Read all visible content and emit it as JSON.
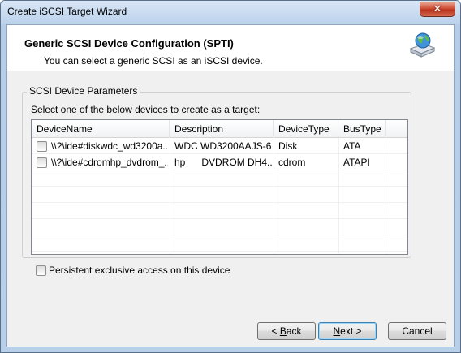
{
  "window": {
    "title": "Create iSCSI Target Wizard",
    "close_glyph": "✕"
  },
  "header": {
    "title": "Generic SCSI Device Configuration (SPTI)",
    "subtitle": "You can select a generic SCSI as an iSCSI device.",
    "icon": "globe-drive-icon"
  },
  "group": {
    "legend": "SCSI Device Parameters",
    "instruction": "Select one of the below devices to create as a target:"
  },
  "table": {
    "columns": [
      "DeviceName",
      "Description",
      "DeviceType",
      "BusType"
    ],
    "rows": [
      {
        "checked": false,
        "name": "\\\\?\\ide#diskwdc_wd3200a...",
        "description": "WDC WD3200AAJS-6...",
        "type": "Disk",
        "bus": "ATA"
      },
      {
        "checked": false,
        "name": "\\\\?\\ide#cdromhp_dvdrom_...",
        "description": "hp      DVDROM DH4...",
        "type": "cdrom",
        "bus": "ATAPI"
      }
    ]
  },
  "persistent": {
    "label": "Persistent exclusive access on this device",
    "checked": false
  },
  "buttons": {
    "back_prefix": "< ",
    "back_mnemonic": "B",
    "back_rest": "ack",
    "next_mnemonic": "N",
    "next_rest": "ext >",
    "cancel": "Cancel"
  },
  "colors": {
    "title_bar": "#bcd2ec",
    "close_button": "#cf4c33",
    "dialog_background": "#f0f0f0"
  }
}
